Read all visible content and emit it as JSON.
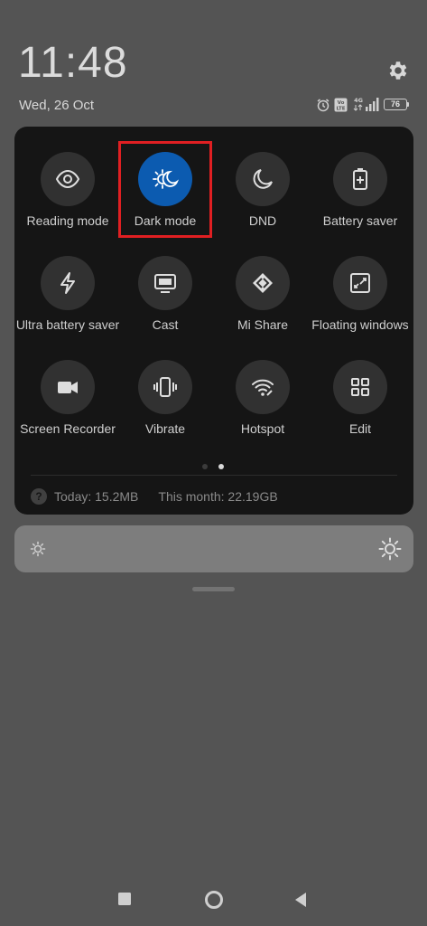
{
  "header": {
    "time": "11:48",
    "date": "Wed, 26 Oct",
    "battery_level": "76",
    "status_icons": [
      "alarm-icon",
      "volte-icon",
      "4g-icon",
      "signal-icon",
      "battery-icon"
    ]
  },
  "quick_settings": {
    "tiles": [
      {
        "label": "Reading mode",
        "icon": "eye-icon",
        "active": false
      },
      {
        "label": "Dark mode",
        "icon": "dark-mode-icon",
        "active": true
      },
      {
        "label": "DND",
        "icon": "moon-icon",
        "active": false
      },
      {
        "label": "Battery saver",
        "icon": "battery-saver-icon",
        "active": false
      },
      {
        "label": "Ultra battery saver",
        "icon": "bolt-icon",
        "active": false
      },
      {
        "label": "Cast",
        "icon": "cast-icon",
        "active": false
      },
      {
        "label": "Mi Share",
        "icon": "mi-share-icon",
        "active": false
      },
      {
        "label": "Floating windows",
        "icon": "floating-windows-icon",
        "active": false
      },
      {
        "label": "Screen Recorder",
        "icon": "screen-recorder-icon",
        "active": false
      },
      {
        "label": "Vibrate",
        "icon": "vibrate-icon",
        "active": false
      },
      {
        "label": "Hotspot",
        "icon": "hotspot-icon",
        "active": false
      },
      {
        "label": "Edit",
        "icon": "edit-grid-icon",
        "active": false
      }
    ],
    "page_count": 2,
    "current_page": 2
  },
  "data_usage": {
    "today": "Today: 15.2MB",
    "month": "This month: 22.19GB"
  },
  "colors": {
    "accent": "#0c5bb0",
    "highlight": "#e01f22",
    "panel": "#151515",
    "background": "#545454"
  },
  "brightness": {
    "level": 1.0
  }
}
